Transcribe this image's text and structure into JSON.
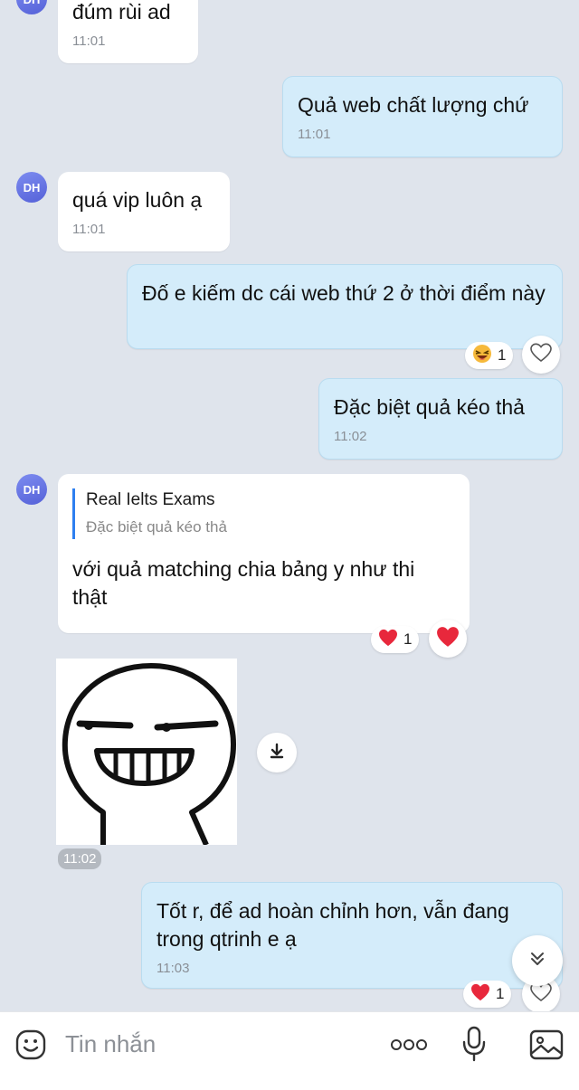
{
  "messages": [
    {
      "sender": "DH",
      "text": "đúm rùi ad",
      "time": "11:01"
    },
    {
      "sender": "me",
      "text": "Quả web chất lượng chứ",
      "time": "11:01"
    },
    {
      "sender": "DH",
      "text": "quá vip luôn ạ",
      "time": "11:01"
    },
    {
      "sender": "me",
      "text": "Đố e kiếm dc cái web thứ 2 ở thời điểm này",
      "reaction_count": "1"
    },
    {
      "sender": "me",
      "text": "Đặc biệt quả kéo thả",
      "time": "11:02"
    },
    {
      "sender": "DH",
      "quote_title": "Real Ielts Exams",
      "quote_text": "Đặc biệt quả kéo thả",
      "text": "với quả matching chia bảng y như thi thật",
      "reaction_count": "1"
    },
    {
      "sender": "DH",
      "type": "sticker",
      "time": "11:02"
    },
    {
      "sender": "me",
      "text": "Tốt r, để ad hoàn chỉnh hơn, vẫn đang trong qtrinh e ạ",
      "time": "11:03",
      "reaction_count": "1"
    }
  ],
  "avatar_initials": "DH",
  "input": {
    "placeholder": "Tin nhắn"
  },
  "icons": {
    "react_laugh": "laughing-face-icon",
    "react_heart": "red-heart-icon",
    "react_empty": "heart-outline-icon",
    "download": "download-arrow-icon",
    "scroll_down": "double-chevron-down-icon",
    "emoji": "emoji-face-icon",
    "more": "three-dots-icon",
    "mic": "microphone-icon",
    "image": "image-gallery-icon"
  },
  "colors": {
    "background": "#dfe4ec",
    "incoming_bubble": "#ffffff",
    "outgoing_bubble": "#d4ecfa",
    "avatar": "#6673e4",
    "quote_bar": "#2d7ff0",
    "heart": "#e8283c"
  }
}
